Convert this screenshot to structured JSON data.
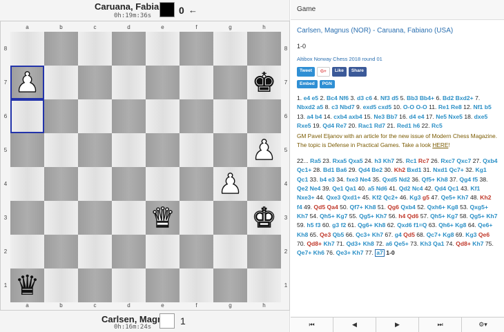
{
  "top_player": {
    "name": "Caruana, Fabiano",
    "clock": "0h:19m:36s",
    "color": "#000000",
    "score": "0",
    "arrow": "←"
  },
  "bottom_player": {
    "name": "Carlsen, Magnus",
    "clock": "0h:16m:24s",
    "color": "#ffffff",
    "score": "1"
  },
  "board": {
    "files": [
      "a",
      "b",
      "c",
      "d",
      "e",
      "f",
      "g",
      "h"
    ],
    "ranks": [
      "8",
      "7",
      "6",
      "5",
      "4",
      "3",
      "2",
      "1"
    ],
    "highlight_squares": [
      "a7",
      "a6"
    ],
    "pieces": [
      {
        "square": "a7",
        "glyph": "♟",
        "side": "w",
        "name": "white-pawn-icon"
      },
      {
        "square": "h7",
        "glyph": "♚",
        "side": "b",
        "name": "black-king-icon"
      },
      {
        "square": "h5",
        "glyph": "♟",
        "side": "w",
        "name": "white-pawn-icon"
      },
      {
        "square": "g4",
        "glyph": "♟",
        "side": "w",
        "name": "white-pawn-icon"
      },
      {
        "square": "e3",
        "glyph": "♛",
        "side": "w",
        "name": "white-queen-icon"
      },
      {
        "square": "h3",
        "glyph": "♚",
        "side": "w",
        "name": "white-king-icon"
      },
      {
        "square": "a1",
        "glyph": "♛",
        "side": "b",
        "name": "black-queen-icon"
      }
    ]
  },
  "panel": {
    "header": "Game",
    "match_title": "Carlsen, Magnus (NOR) - Caruana, Fabiano (USA)",
    "result": "1-0",
    "event": "Altibox Norway Chess 2018 round 01",
    "share_buttons": [
      "Tweet",
      "G+",
      "Like",
      "Share"
    ],
    "tool_buttons": [
      "Embed",
      "PGN"
    ],
    "annotation": {
      "text": "GM Pavel Eljanov with an article for the new issue of Modern Chess Magazine. The topic is Defense in Practical Games. Take a look ",
      "link": "HERE",
      "after": "!"
    },
    "moves_a": "1. e4 e5 2. Bc4 Nf6 3. d3 c6 4. Nf3 d5 5. Bb3 Bb4+ 6. Bd2 Bxd2+ 7. Nbxd2 a5 8. c3 Nbd7 9. exd5 cxd5 10. O-O O-O 11. Re1 Re8 12. Nf1 b5 13. a4 b4 14. cxb4 axb4 15. Ne3 Bb7 16. d4 e4 17. Ne5 Nxe5 18. dxe5 Rxe5 19. Qd4 Re7 20. Rac1 Rd7 21. Red1 h6 22. Rc5",
    "moves_b": "22... Ra5 23. Rxa5 Qxa5 24. h3 Kh7 25. Rc1 Rc7 26. Rxc7 Qxc7 27. Qxb4 Qc1+ 28. Bd1 Ba6 29. Qd4 Be2 30. Kh2 Bxd1 31. Nxd1 Qc7+ 32. Kg1 Qc1 33. b4 e3 34. fxe3 Ne4 35. Qxd5 Nd2 36. Qf5+ Kh8 37. Qg4 f5 38. Qe2 Ne4 39. Qe1 Qa1 40. a5 Nd6 41. Qd2 Nc4 42. Qd4 Qc1 43. Kf1 Nxe3+ 44. Qxe3 Qxd1+ 45. Kf2 Qc2+ 46. Kg3 g5 47. Qe5+ Kh7 48. Kh2 f4 49. Qd5 Qa4 50. Qf7+ Kh8 51. Qg6 Qxb4 52. Qxh6+ Kg8 53. Qxg5+ Kh7 54. Qh5+ Kg7 55. Qg5+ Kh7 56. h4 Qd6 57. Qh5+ Kg7 58. Qg5+ Kh7 59. h5 f3 60. g3 f2 61. Qg6+ Kh8 62. Qxd6 f1=Q 63. Qh6+ Kg8 64. Qe6+ Kh8 65. Qe3 Qb5 66. Qc3+ Kh7 67. g4 Qd5 68. Qc7+ Kg8 69. Kg3 Qe6 70. Qd8+ Kh7 71. Qd3+ Kh8 72. a6 Qe5+ 73. Kh3 Qa1 74. Qd8+ Kh7 75. Qe7+ Kh6 76. Qe3+ Kh7 77.",
    "current_move": "a7",
    "final_result": "1-0",
    "nav": [
      "⏮",
      "◀",
      "▶",
      "⏭",
      "⚙▾"
    ]
  },
  "colors": {
    "link": "#2a6fb0",
    "move": "#2a8fc6",
    "bad_move": "#c0392b",
    "highlight": "#2233aa"
  }
}
